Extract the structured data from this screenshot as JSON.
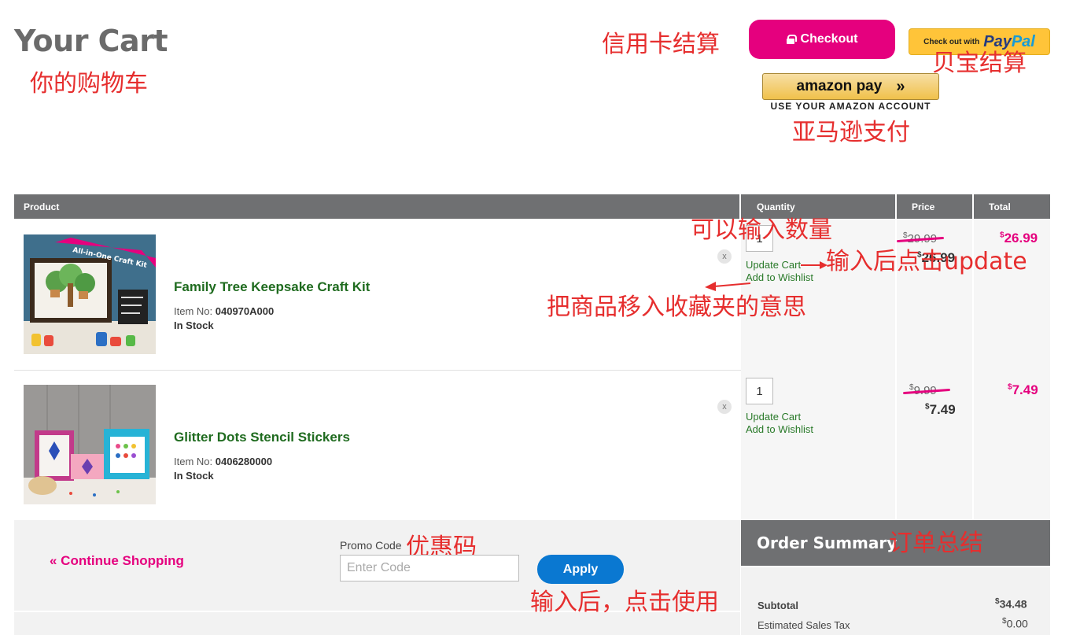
{
  "header": {
    "title": "Your Cart",
    "checkout_label": "Checkout",
    "paypal_prefix": "Check out with",
    "paypal_pay": "Pay",
    "paypal_pal": "Pal",
    "amazon_logo": "amazon pay",
    "amazon_arrows": "»",
    "amazon_sub": "USE YOUR AMAZON ACCOUNT"
  },
  "annotations": {
    "your_cart": "你的购物车",
    "credit_card": "信用卡结算",
    "paypal": "贝宝结算",
    "amazon": "亚马逊支付",
    "quantity_hint": "可以输入数量",
    "update_hint": "输入后点击update",
    "wishlist_hint": "把商品移入收藏夹的意思",
    "promo_hint": "优惠码",
    "apply_hint": "输入后，点击使用",
    "summary_hint": "订单总结"
  },
  "table": {
    "headers": [
      "Product",
      "Quantity",
      "Price",
      "Total"
    ]
  },
  "items": [
    {
      "name": "Family Tree Keepsake Craft Kit",
      "item_no_label": "Item No:",
      "item_no": "040970A000",
      "stock": "In Stock",
      "remove": "x",
      "quantity": "1",
      "update_label": "Update Cart",
      "wishlist_label": "Add to Wishlist",
      "price_old": "29.99",
      "price_new": "26.99",
      "total": "26.99",
      "currency": "$",
      "image_badge": "All-in-One Craft Kit"
    },
    {
      "name": "Glitter Dots Stencil Stickers",
      "item_no_label": "Item No:",
      "item_no": "0406280000",
      "stock": "In Stock",
      "remove": "x",
      "quantity": "1",
      "update_label": "Update Cart",
      "wishlist_label": "Add to Wishlist",
      "price_old": "9.99",
      "price_new": "7.49",
      "total": "7.49",
      "currency": "$"
    }
  ],
  "footer": {
    "continue_label": "« Continue Shopping",
    "promo_label": "Promo Code",
    "promo_placeholder": "Enter Code",
    "apply_label": "Apply"
  },
  "summary": {
    "title": "Order Summary",
    "subtotal_label": "Subtotal",
    "subtotal_value": "34.48",
    "tax_label": "Estimated Sales Tax",
    "tax_value": "0.00",
    "currency": "$"
  },
  "colors": {
    "accent_pink": "#e5007e",
    "product_green": "#1f6b1f",
    "header_gray": "#6f7072",
    "apply_blue": "#0a78d1",
    "annotation_red": "#e62e2e"
  }
}
